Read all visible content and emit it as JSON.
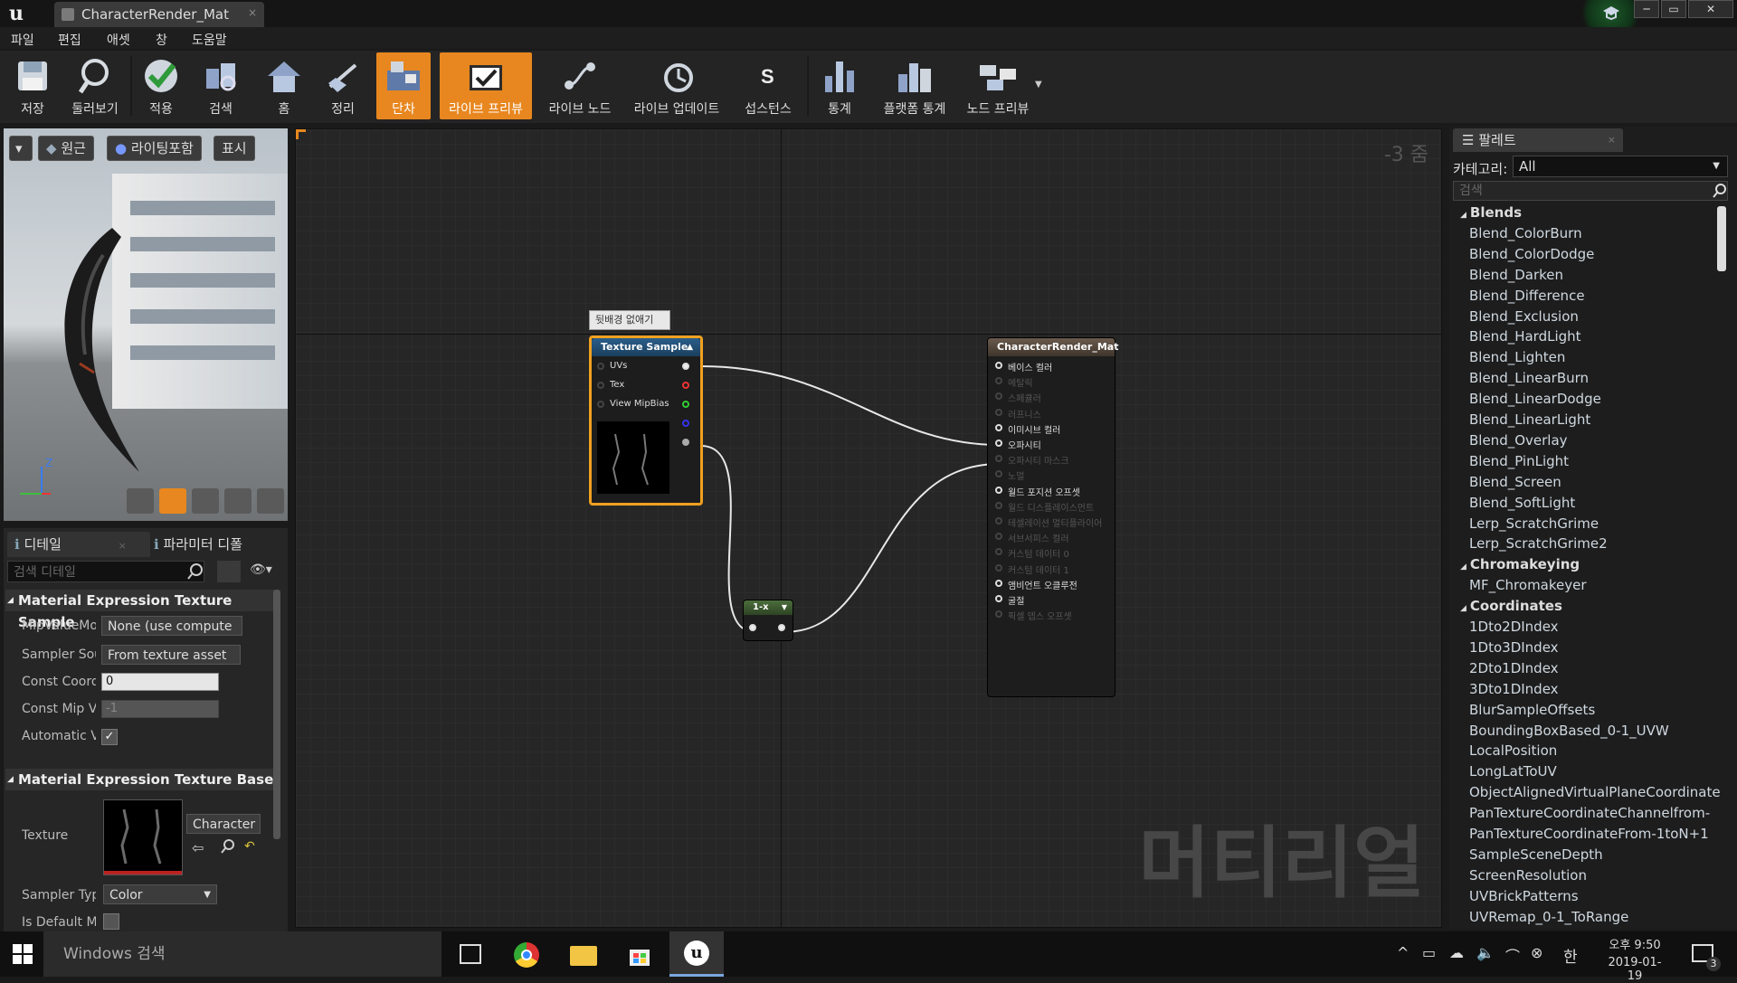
{
  "window": {
    "tab_title": "CharacterRender_Mat",
    "tab_close": "×",
    "logo": "u"
  },
  "menu": [
    "파일",
    "편집",
    "애셋",
    "창",
    "도움말"
  ],
  "toolbar": {
    "buttons": [
      {
        "label": "저장",
        "icon": "save-icon"
      },
      {
        "label": "둘러보기",
        "icon": "browse-icon"
      },
      {
        "label": "적용",
        "icon": "apply-icon"
      },
      {
        "label": "검색",
        "icon": "search-icon"
      },
      {
        "label": "홈",
        "icon": "home-icon"
      },
      {
        "label": "정리",
        "icon": "clean-icon"
      },
      {
        "label": "단차",
        "icon": "stats-icon",
        "active": true
      },
      {
        "label": "라이브 프리뷰",
        "icon": "live-preview-icon",
        "active": true
      },
      {
        "label": "라이브 노드",
        "icon": "live-nodes-icon"
      },
      {
        "label": "라이브 업데이트",
        "icon": "live-update-icon"
      },
      {
        "label": "섭스턴스",
        "icon": "substance-icon"
      },
      {
        "label": "통계",
        "icon": "stats-icon"
      },
      {
        "label": "플랫폼 통계",
        "icon": "platform-stats-icon"
      },
      {
        "label": "노드 프리뷰",
        "icon": "node-preview-icon"
      }
    ]
  },
  "viewport": {
    "btn_perspective": "원근",
    "btn_lit": "라이팅포함",
    "btn_show": "표시",
    "axis_z": "Z"
  },
  "details": {
    "tab_details": "디테일",
    "tab_params": "파라미터 디폴",
    "search_placeholder": "검색 디테일",
    "section1": "Material Expression Texture Sample",
    "mip_label": "MipValueMo",
    "mip_value": "None (use compute",
    "sampler_src_label": "Sampler Sou",
    "sampler_src_value": "From texture asset",
    "const_coord_label": "Const Coordi",
    "const_coord_value": "0",
    "const_mip_label": "Const Mip V.",
    "const_mip_value": "-1",
    "automatic_label": "Automatic V",
    "section2": "Material Expression Texture Base",
    "texture_label": "Texture",
    "texture_value": "Character",
    "sampler_type_label": "Sampler Typ",
    "sampler_type_value": "Color",
    "is_default_label": "Is Default M"
  },
  "graph": {
    "zoom": "-3 줌",
    "watermark": "머티리얼",
    "comment": "뒷배경 없애기",
    "texture_node": {
      "title": "Texture Sample",
      "pins": [
        "UVs",
        "Tex",
        "View MipBias"
      ]
    },
    "oneminus_node": {
      "title": "1-x"
    },
    "result_node": {
      "title": "CharacterRender_Mat",
      "pins": [
        {
          "label": "베이스 컬러",
          "active": true
        },
        {
          "label": "메탈릭",
          "active": false
        },
        {
          "label": "스페큘러",
          "active": false
        },
        {
          "label": "러프니스",
          "active": false
        },
        {
          "label": "이미시브 컬러",
          "active": true
        },
        {
          "label": "오파시티",
          "active": true
        },
        {
          "label": "오파시티 마스크",
          "active": false
        },
        {
          "label": "노멀",
          "active": false
        },
        {
          "label": "월드 포지션 오프셋",
          "active": true
        },
        {
          "label": "월드 디스플레이스먼트",
          "active": false
        },
        {
          "label": "테셀레이션 멀티플라이어",
          "active": false
        },
        {
          "label": "서브서피스 컬러",
          "active": false
        },
        {
          "label": "커스텀 데이터 0",
          "active": false
        },
        {
          "label": "커스텀 데이터 1",
          "active": false
        },
        {
          "label": "앰비언트 오클루전",
          "active": true
        },
        {
          "label": "굴절",
          "active": true
        },
        {
          "label": "픽셀 뎁스 오프셋",
          "active": false
        }
      ]
    }
  },
  "palette": {
    "title": "팔레트",
    "category_label": "카테고리:",
    "category_value": "All",
    "search_placeholder": "검색",
    "groups": [
      {
        "name": "Blends",
        "items": [
          "Blend_ColorBurn",
          "Blend_ColorDodge",
          "Blend_Darken",
          "Blend_Difference",
          "Blend_Exclusion",
          "Blend_HardLight",
          "Blend_Lighten",
          "Blend_LinearBurn",
          "Blend_LinearDodge",
          "Blend_LinearLight",
          "Blend_Overlay",
          "Blend_PinLight",
          "Blend_Screen",
          "Blend_SoftLight",
          "Lerp_ScratchGrime",
          "Lerp_ScratchGrime2"
        ]
      },
      {
        "name": "Chromakeying",
        "items": [
          "MF_Chromakeyer"
        ]
      },
      {
        "name": "Coordinates",
        "items": [
          "1Dto2DIndex",
          "1Dto3DIndex",
          "2Dto1DIndex",
          "3Dto1DIndex",
          "BlurSampleOffsets",
          "BoundingBoxBased_0-1_UVW",
          "LocalPosition",
          "LongLatToUV",
          "ObjectAlignedVirtualPlaneCoordinate",
          "PanTextureCoordinateChannelfrom-",
          "PanTextureCoordinateFrom-1toN+1",
          "SampleSceneDepth",
          "ScreenResolution",
          "UVBrickPatterns",
          "UVRemap_0-1_ToRange"
        ]
      }
    ]
  },
  "taskbar": {
    "search_placeholder": "Windows 검색",
    "ime": "한",
    "time": "오후 9:50",
    "date": "2019-01-19",
    "notifications": "3"
  }
}
